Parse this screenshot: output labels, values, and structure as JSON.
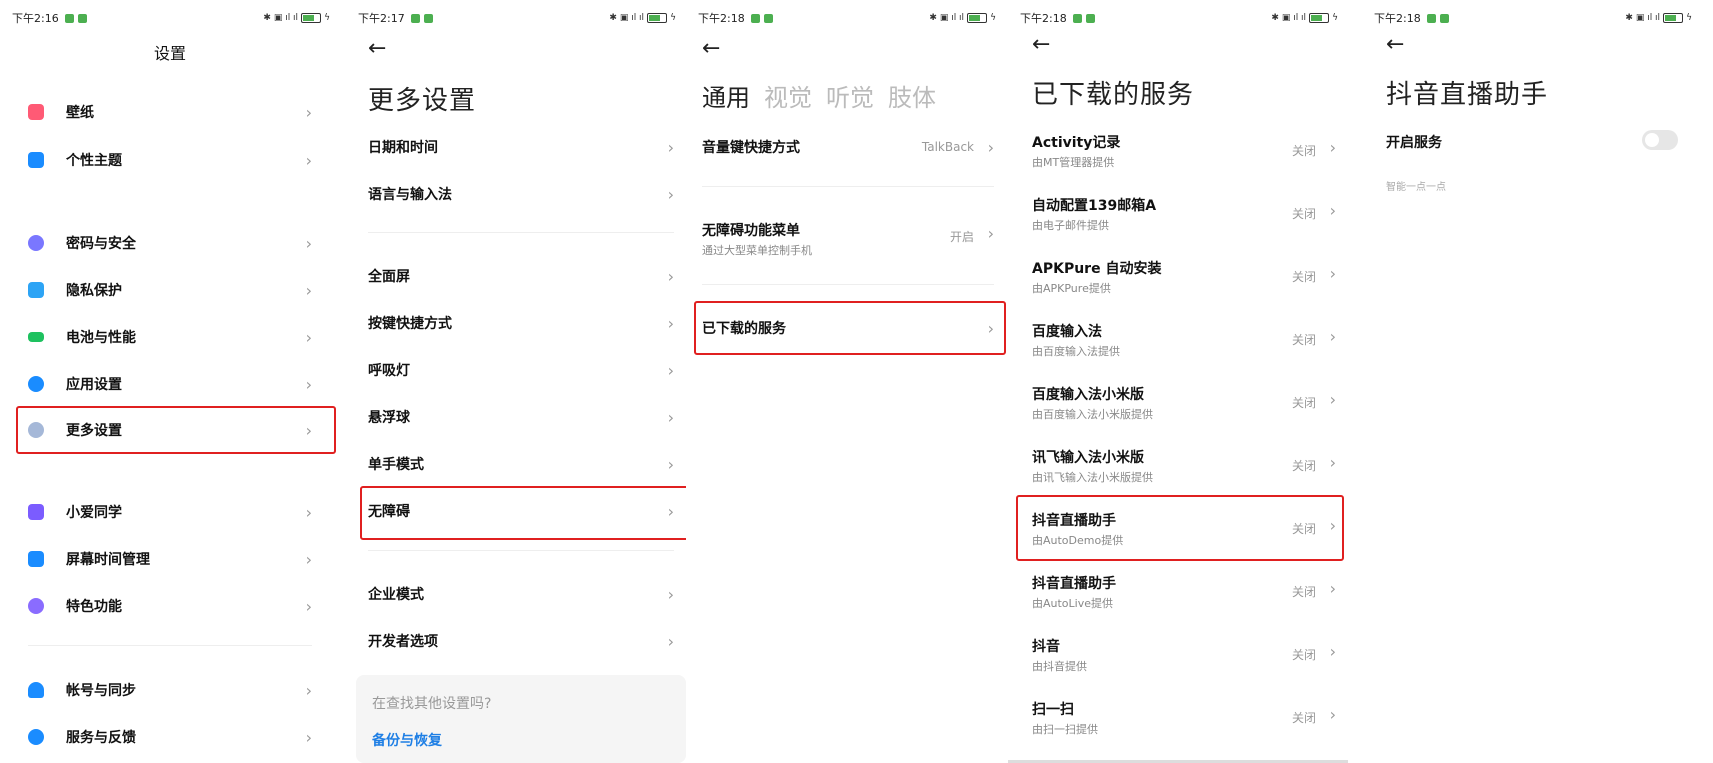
{
  "colors": {
    "accent": "#1f7fe5",
    "highlight_box": "#e02020"
  },
  "p1": {
    "status_time": "下午2:16",
    "title": "设置",
    "items": [
      {
        "label": "壁纸",
        "icon": "wallpaper-icon",
        "color": "#ff5a75"
      },
      {
        "label": "个性主题",
        "icon": "theme-icon",
        "color": "#1a8cff"
      },
      {
        "label": "密码与安全",
        "icon": "fingerprint-icon",
        "color": "#7a77ff"
      },
      {
        "label": "隐私保护",
        "icon": "privacy-shield-icon",
        "color": "#2da4f5"
      },
      {
        "label": "电池与性能",
        "icon": "battery-icon",
        "color": "#1ec15f"
      },
      {
        "label": "应用设置",
        "icon": "gear-icon",
        "color": "#1a8cff"
      },
      {
        "label": "更多设置",
        "icon": "more-dots-icon",
        "color": "#a5b8d8"
      },
      {
        "label": "小爱同学",
        "icon": "xiaoai-icon",
        "color": "#7b5cff"
      },
      {
        "label": "屏幕时间管理",
        "icon": "screen-time-icon",
        "color": "#1a8cff"
      },
      {
        "label": "特色功能",
        "icon": "flask-icon",
        "color": "#8a6cff"
      },
      {
        "label": "帐号与同步",
        "icon": "account-icon",
        "color": "#1a8cff"
      },
      {
        "label": "服务与反馈",
        "icon": "help-icon",
        "color": "#1a8cff"
      }
    ]
  },
  "p2": {
    "status_time": "下午2:17",
    "title": "更多设置",
    "items": [
      "日期和时间",
      "语言与输入法",
      "全面屏",
      "按键快捷方式",
      "呼吸灯",
      "悬浮球",
      "单手模式",
      "无障碍",
      "企业模式",
      "开发者选项"
    ],
    "hint_text": "在查找其他设置吗?",
    "hint_link": "备份与恢复"
  },
  "p3": {
    "status_time": "下午2:18",
    "tabs": [
      "通用",
      "视觉",
      "听觉",
      "肢体"
    ],
    "items": [
      {
        "label": "音量键快捷方式",
        "value": "TalkBack",
        "sub": ""
      },
      {
        "label": "无障碍功能菜单",
        "value": "开启",
        "sub": "通过大型菜单控制手机"
      },
      {
        "label": "已下载的服务",
        "value": "",
        "sub": ""
      }
    ]
  },
  "p4": {
    "status_time": "下午2:18",
    "title": "已下载的服务",
    "off_label": "关闭",
    "items": [
      {
        "name": "Activity记录",
        "provider": "由MT管理器提供"
      },
      {
        "name": "自动配置139邮箱A",
        "provider": "由电子邮件提供"
      },
      {
        "name": "APKPure 自动安装",
        "provider": "由APKPure提供"
      },
      {
        "name": "百度输入法",
        "provider": "由百度输入法提供"
      },
      {
        "name": "百度输入法小米版",
        "provider": "由百度输入法小米版提供"
      },
      {
        "name": "讯飞输入法小米版",
        "provider": "由讯飞输入法小米版提供"
      },
      {
        "name": "抖音直播助手",
        "provider": "由AutoDemo提供"
      },
      {
        "name": "抖音直播助手",
        "provider": "由AutoLive提供"
      },
      {
        "name": "抖音",
        "provider": "由抖音提供"
      },
      {
        "name": "扫一扫",
        "provider": "由扫一扫提供"
      }
    ]
  },
  "p5": {
    "status_time": "下午2:18",
    "title": "抖音直播助手",
    "toggle_label": "开启服务",
    "toggle_state": "off",
    "desc": "智能一点一点"
  }
}
